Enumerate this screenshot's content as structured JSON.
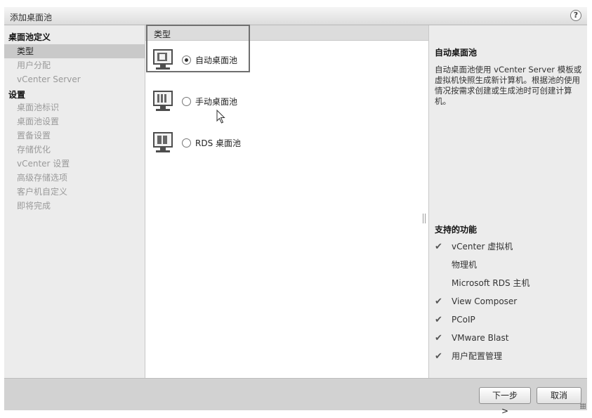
{
  "window": {
    "title": "添加桌面池",
    "help_label": "?"
  },
  "sidebar": {
    "sections": [
      {
        "label": "桌面池定义"
      },
      {
        "label": "设置"
      }
    ],
    "items": [
      {
        "label": "类型",
        "selected": true
      },
      {
        "label": "用户分配"
      },
      {
        "label": "vCenter Server"
      },
      {
        "label": "桌面池标识"
      },
      {
        "label": "桌面池设置"
      },
      {
        "label": "置备设置"
      },
      {
        "label": "存储优化"
      },
      {
        "label": "vCenter 设置"
      },
      {
        "label": "高级存储选项"
      },
      {
        "label": "客户机自定义"
      },
      {
        "label": "即将完成"
      }
    ]
  },
  "main": {
    "header": "类型",
    "options": [
      {
        "label": "自动桌面池",
        "checked": true,
        "icon": "automated-pool-icon"
      },
      {
        "label": "手动桌面池",
        "checked": false,
        "icon": "manual-pool-icon"
      },
      {
        "label": "RDS 桌面池",
        "checked": false,
        "icon": "rds-pool-icon"
      }
    ]
  },
  "description": {
    "title": "自动桌面池",
    "text": "自动桌面池使用 vCenter Server 模板或虚拟机快照生成新计算机。根据池的使用情况按需求创建或生成池时可创建计算机。",
    "features_title": "支持的功能",
    "features": [
      {
        "name": "vCenter 虚拟机",
        "supported": true
      },
      {
        "name": "物理机",
        "supported": false
      },
      {
        "name": "Microsoft RDS 主机",
        "supported": false
      },
      {
        "name": "View Composer",
        "supported": true
      },
      {
        "name": "PCoIP",
        "supported": true
      },
      {
        "name": "VMware Blast",
        "supported": true
      },
      {
        "name": "用户配置管理",
        "supported": true
      }
    ],
    "check_glyph": "✔"
  },
  "footer": {
    "next_label": "下一步 >",
    "cancel_label": "取消"
  }
}
